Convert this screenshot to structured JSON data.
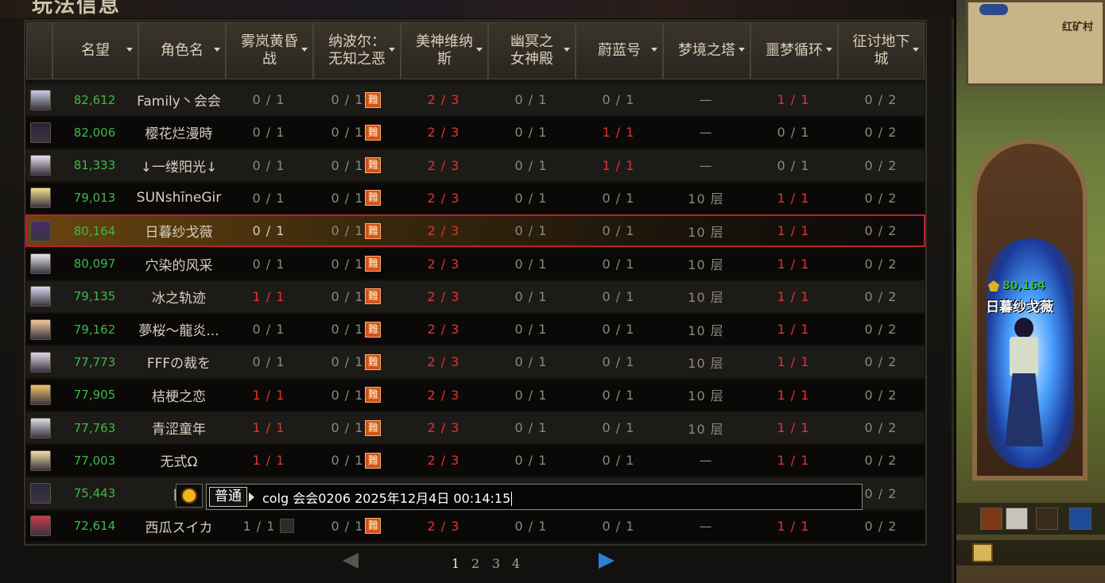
{
  "panel": {
    "title": "玩法信息"
  },
  "columns": {
    "fame": "名望",
    "name": "角色名",
    "dungeons": [
      "雾岚黄昏战",
      "纳波尔：无知之恶",
      "美神维纳斯",
      "幽冥之女神殿",
      "蔚蓝号",
      "梦境之塔",
      "噩梦循环",
      "征讨地下城"
    ]
  },
  "hard_badge": "難",
  "rows": [
    {
      "fame": "82,612",
      "name": "Family丶会会",
      "d": [
        "0 / 1",
        "0 / 1",
        "2 / 3",
        "0 / 1",
        "0 / 1",
        "—",
        "1 / 1",
        "0 / 2"
      ]
    },
    {
      "fame": "82,006",
      "name": "樱花烂漫時",
      "d": [
        "0 / 1",
        "0 / 1",
        "2 / 3",
        "0 / 1",
        "1 / 1",
        "—",
        "0 / 1",
        "0 / 2"
      ]
    },
    {
      "fame": "81,333",
      "name": "↓一缕阳光↓",
      "d": [
        "0 / 1",
        "0 / 1",
        "2 / 3",
        "0 / 1",
        "1 / 1",
        "—",
        "0 / 1",
        "0 / 2"
      ]
    },
    {
      "fame": "79,013",
      "name": "SUNshīneGir",
      "d": [
        "0 / 1",
        "0 / 1",
        "2 / 3",
        "0 / 1",
        "0 / 1",
        "10 层",
        "1 / 1",
        "0 / 2"
      ]
    },
    {
      "fame": "80,164",
      "name": "日暮纱戈薇",
      "d": [
        "0 / 1",
        "0 / 1",
        "2 / 3",
        "0 / 1",
        "0 / 1",
        "10 层",
        "1 / 1",
        "0 / 2"
      ]
    },
    {
      "fame": "80,097",
      "name": "穴染的风采",
      "d": [
        "0 / 1",
        "0 / 1",
        "2 / 3",
        "0 / 1",
        "0 / 1",
        "10 层",
        "1 / 1",
        "0 / 2"
      ]
    },
    {
      "fame": "79,135",
      "name": "冰之轨迹",
      "d": [
        "1 / 1",
        "0 / 1",
        "2 / 3",
        "0 / 1",
        "0 / 1",
        "10 层",
        "1 / 1",
        "0 / 2"
      ]
    },
    {
      "fame": "79,162",
      "name": "夢桜～龍炎...",
      "d": [
        "0 / 1",
        "0 / 1",
        "2 / 3",
        "0 / 1",
        "0 / 1",
        "10 层",
        "1 / 1",
        "0 / 2"
      ]
    },
    {
      "fame": "77,773",
      "name": "FFFの裁を",
      "d": [
        "0 / 1",
        "0 / 1",
        "2 / 3",
        "0 / 1",
        "0 / 1",
        "10 层",
        "1 / 1",
        "0 / 2"
      ]
    },
    {
      "fame": "77,905",
      "name": "桔梗之恋",
      "d": [
        "1 / 1",
        "0 / 1",
        "2 / 3",
        "0 / 1",
        "0 / 1",
        "10 层",
        "1 / 1",
        "0 / 2"
      ]
    },
    {
      "fame": "77,763",
      "name": "青涩童年",
      "d": [
        "1 / 1",
        "0 / 1",
        "2 / 3",
        "0 / 1",
        "0 / 1",
        "10 层",
        "1 / 1",
        "0 / 2"
      ]
    },
    {
      "fame": "77,003",
      "name": "无式Ω",
      "d": [
        "1 / 1",
        "0 / 1",
        "2 / 3",
        "0 / 1",
        "0 / 1",
        "—",
        "1 / 1",
        "0 / 2"
      ]
    },
    {
      "fame": "75,443",
      "name": "日",
      "d": [
        "",
        "",
        "",
        "",
        "",
        "",
        "",
        "0 / 2"
      ]
    },
    {
      "fame": "72,614",
      "name": "西瓜スイカ",
      "d": [
        "1 / 1",
        "0 / 1",
        "2 / 3",
        "0 / 1",
        "0 / 1",
        "—",
        "1 / 1",
        "0 / 2"
      ]
    }
  ],
  "selected_row": 4,
  "pagination": {
    "pages": [
      "1",
      "2",
      "3",
      "4"
    ],
    "current": "1"
  },
  "chat": {
    "channel": "普通",
    "text": "colg 会会0206 2025年12月4日 00:14:15"
  },
  "scene": {
    "minimap_label": "红矿村",
    "player_fame": "80,164",
    "player_name": "日暮纱戈薇"
  },
  "colors": {
    "fame_green": "#3fb845",
    "complete_red": "#e13232",
    "selected_border": "#b8222a",
    "next_arrow_blue": "#2e7fd6"
  }
}
